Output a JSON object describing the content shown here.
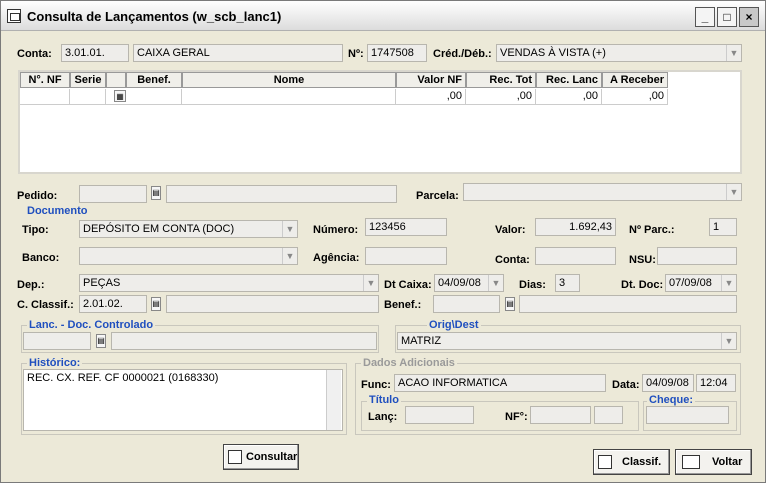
{
  "window": {
    "title": "Consulta de Lançamentos (w_scb_lanc1)"
  },
  "header": {
    "conta_label": "Conta:",
    "conta_code": "3.01.01.",
    "conta_name": "CAIXA GERAL",
    "num_label": "Nº:",
    "num_value": "1747508",
    "cred_label": "Créd./Déb.:",
    "cred_value": "VENDAS À VISTA (+)"
  },
  "grid": {
    "headers": [
      "N°. NF",
      "Serie",
      "Benef.",
      "Nome",
      "Valor NF",
      "Rec. Tot",
      "Rec. Lanc",
      "A Receber"
    ],
    "row": {
      "valor_nf": ",00",
      "rec_tot": ",00",
      "rec_lanc": ",00",
      "a_receber": ",00"
    }
  },
  "pedido": {
    "label": "Pedido:",
    "parcela_label": "Parcela:"
  },
  "documento": {
    "section": "Documento",
    "tipo_label": "Tipo:",
    "tipo_value": "DEPÓSITO EM CONTA (DOC)",
    "numero_label": "Número:",
    "numero_value": "123456",
    "valor_label": "Valor:",
    "valor_value": "1.692,43",
    "nparc_label": "Nº Parc.:",
    "nparc_value": "1",
    "banco_label": "Banco:",
    "agencia_label": "Agência:",
    "conta_label": "Conta:",
    "nsu_label": "NSU:"
  },
  "dep": {
    "label": "Dep.:",
    "value": "PEÇAS",
    "dtcaixa_label": "Dt Caixa:",
    "dtcaixa_value": "04/09/08",
    "dias_label": "Dias:",
    "dias_value": "3",
    "dtdoc_label": "Dt. Doc:",
    "dtdoc_value": "07/09/08"
  },
  "classif": {
    "label": "C. Classif.:",
    "value": "2.01.02.",
    "benef_label": "Benef.:"
  },
  "lanc": {
    "section": "Lanc. - Doc. Controlado"
  },
  "orig": {
    "section": "Orig\\Dest",
    "value": "MATRIZ"
  },
  "historico": {
    "section": "Histórico:",
    "text": "REC. CX. REF. CF 0000021 (0168330)"
  },
  "adicionais": {
    "section": "Dados Adicionais",
    "func_label": "Func:",
    "func_value": "ACAO INFORMATICA",
    "data_label": "Data:",
    "data_value": "04/09/08",
    "hora_value": "12:04",
    "titulo_section": "Título",
    "lanc_label": "Lanç:",
    "nf_label": "NF°:",
    "cheque_section": "Cheque:"
  },
  "buttons": {
    "consultar": "Consultar",
    "classif": "Classif.",
    "voltar": "Voltar"
  },
  "colors": {
    "section_blue": "#1f4fbf",
    "field_bg": "#eeedea",
    "window_bg": "#ece9d8"
  }
}
